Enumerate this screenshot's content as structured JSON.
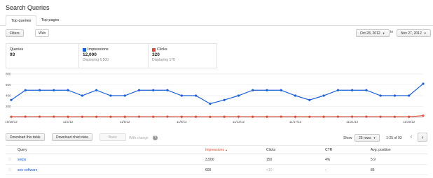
{
  "page": {
    "title": "Search Queries"
  },
  "tabs": [
    {
      "label": "Top queries",
      "active": true
    },
    {
      "label": "Top pages",
      "active": false
    }
  ],
  "toolbar": {
    "filters_label": "Filters",
    "web_label": "Web",
    "start_date": "Oct 28, 2012",
    "to_label": "to",
    "end_date": "Nov 27, 2012",
    "caret_icon": "triangle-down-icon"
  },
  "stats": {
    "queries": {
      "label": "Queries",
      "value": "93"
    },
    "impressions": {
      "label": "Impressions",
      "value": "12,000",
      "sub": "Displaying 6,500",
      "color": "#1a5ed6"
    },
    "clicks": {
      "label": "Clicks",
      "value": "320",
      "sub": "Displaying 170",
      "color": "#dd4b39"
    }
  },
  "chart_data": {
    "type": "line",
    "x": [
      "10/28/12",
      "10/29/12",
      "10/30/12",
      "10/31/12",
      "11/1/12",
      "11/2/12",
      "11/3/12",
      "11/4/12",
      "11/5/12",
      "11/6/12",
      "11/7/12",
      "11/8/12",
      "11/9/12",
      "11/10/12",
      "11/11/12",
      "11/12/12",
      "11/13/12",
      "11/14/12",
      "11/15/12",
      "11/16/12",
      "11/17/12",
      "11/18/12",
      "11/19/12",
      "11/20/12",
      "11/21/12",
      "11/22/12",
      "11/23/12",
      "11/24/12",
      "11/25/12",
      "11/26/12"
    ],
    "series": [
      {
        "name": "Impressions",
        "color": "#1a5ed6",
        "values": [
          320,
          500,
          500,
          500,
          500,
          400,
          500,
          400,
          400,
          500,
          500,
          500,
          400,
          400,
          250,
          320,
          400,
          500,
          500,
          500,
          400,
          320,
          400,
          500,
          500,
          500,
          400,
          400,
          400,
          620
        ]
      },
      {
        "name": "Clicks",
        "color": "#dd4b39",
        "values": [
          10,
          12,
          12,
          12,
          10,
          10,
          10,
          10,
          10,
          12,
          10,
          12,
          10,
          10,
          8,
          10,
          12,
          10,
          10,
          12,
          10,
          10,
          10,
          12,
          12,
          12,
          10,
          10,
          10,
          30
        ]
      }
    ],
    "y_ticks": [
      "800",
      "600",
      "400",
      "200"
    ],
    "x_tick_labels": [
      "10/28/12",
      "11/1/12",
      "11/5/12",
      "11/9/12",
      "11/13/12",
      "11/17/12",
      "11/21/12",
      "11/25/12"
    ],
    "ylim": [
      0,
      800
    ],
    "grid": true
  },
  "controls": {
    "download_table": "Download this table",
    "download_chart": "Download chart data",
    "basic": "Basic",
    "with_change": "With change",
    "help_icon": "question-icon",
    "show_label": "Show",
    "rows_value": "25 rows",
    "range_label": "1-25 of 93",
    "prev_icon": "chevron-left-icon",
    "next_icon": "chevron-right-icon"
  },
  "table": {
    "columns": [
      "Query",
      "Impressions",
      "Clicks",
      "CTR",
      "Avg. position"
    ],
    "sort_indicator": "▲",
    "rows": [
      {
        "query": "serps",
        "impressions": "3,500",
        "clicks": "150",
        "ctr": "4%",
        "position": "5.9"
      },
      {
        "query": "seo software",
        "impressions": "600",
        "clicks": "<10",
        "ctr": "-",
        "position": "86"
      }
    ]
  }
}
